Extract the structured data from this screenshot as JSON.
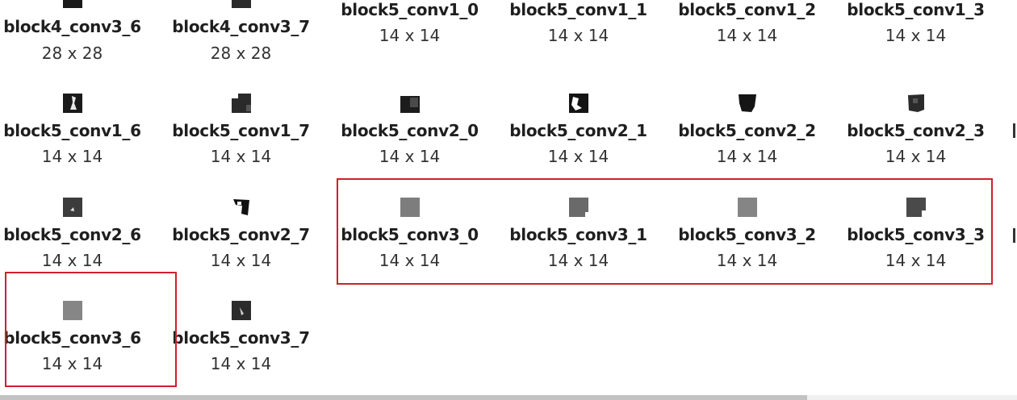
{
  "grid": {
    "rows": [
      {
        "items": [
          {
            "name": "block4_conv3_6",
            "dims": "28 x 28"
          },
          {
            "name": "block4_conv3_7",
            "dims": "28 x 28"
          },
          {
            "name": "block5_conv1_0",
            "dims": "14 x 14"
          },
          {
            "name": "block5_conv1_1",
            "dims": "14 x 14"
          },
          {
            "name": "block5_conv1_2",
            "dims": "14 x 14"
          },
          {
            "name": "block5_conv1_3",
            "dims": "14 x 14"
          }
        ]
      },
      {
        "items": [
          {
            "name": "block5_conv1_6",
            "dims": "14 x 14"
          },
          {
            "name": "block5_conv1_7",
            "dims": "14 x 14"
          },
          {
            "name": "block5_conv2_0",
            "dims": "14 x 14"
          },
          {
            "name": "block5_conv2_1",
            "dims": "14 x 14"
          },
          {
            "name": "block5_conv2_2",
            "dims": "14 x 14"
          },
          {
            "name": "block5_conv2_3",
            "dims": "14 x 14"
          }
        ]
      },
      {
        "items": [
          {
            "name": "block5_conv2_6",
            "dims": "14 x 14"
          },
          {
            "name": "block5_conv2_7",
            "dims": "14 x 14"
          },
          {
            "name": "block5_conv3_0",
            "dims": "14 x 14"
          },
          {
            "name": "block5_conv3_1",
            "dims": "14 x 14"
          },
          {
            "name": "block5_conv3_2",
            "dims": "14 x 14"
          },
          {
            "name": "block5_conv3_3",
            "dims": "14 x 14"
          }
        ]
      },
      {
        "items": [
          {
            "name": "block5_conv3_6",
            "dims": "14 x 14"
          },
          {
            "name": "block5_conv3_7",
            "dims": "14 x 14"
          }
        ]
      }
    ]
  },
  "colors": {
    "highlight_border": "#d0202a",
    "text": "#1f1f1f",
    "thumb_gray": "#808080",
    "thumb_dark": "#2a2a2a"
  }
}
